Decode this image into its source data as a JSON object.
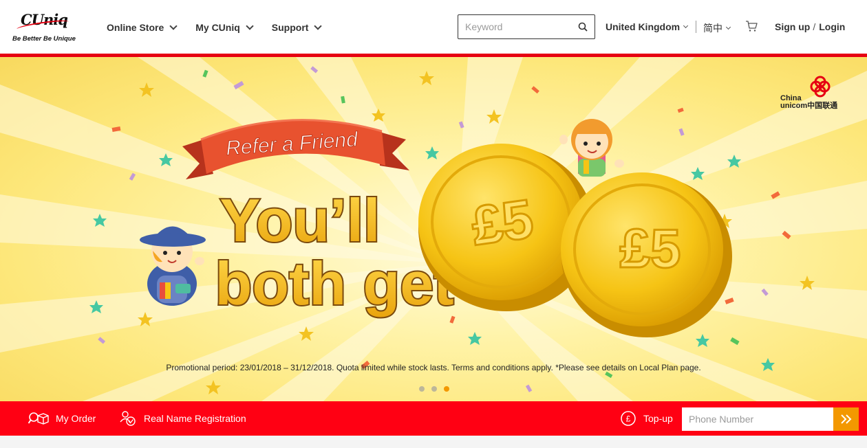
{
  "header": {
    "logo": {
      "mark": "CUniq",
      "tagline": "Be Better Be Unique"
    },
    "nav": [
      {
        "label": "Online Store",
        "icon": "chevron-down-icon"
      },
      {
        "label": "My CUniq",
        "icon": "chevron-down-icon"
      },
      {
        "label": "Support",
        "icon": "chevron-down-icon"
      }
    ],
    "search": {
      "placeholder": "Keyword",
      "value": "",
      "icon": "search-icon"
    },
    "region": "United Kingdom",
    "language": "简中",
    "cart_icon": "cart-icon",
    "sign_up": "Sign up",
    "separator": "/",
    "login": "Login",
    "accent_color": "#e60012"
  },
  "banner": {
    "ribbon_text": "Refer a Friend",
    "headline_line1": "You’ll",
    "headline_line2": "both get",
    "coin_1": "£5",
    "coin_2": "£5",
    "brand_logo": {
      "line1": "China",
      "line2": "unicom中国联通"
    },
    "promo_text": "Promotional period: 23/01/2018 – 31/12/2018. Quota limited while stock lasts. Terms and conditions apply.  *Please see details on Local Plan page.",
    "carousel": {
      "count": 3,
      "active_index": 3,
      "active_color": "#f39800"
    }
  },
  "bottom_bar": {
    "my_order": "My Order",
    "real_name": "Real Name Registration",
    "topup": "Top-up",
    "phone_placeholder": "Phone Number",
    "go_icon": "double-chevron-right-icon",
    "bar_color": "#ff0013"
  }
}
